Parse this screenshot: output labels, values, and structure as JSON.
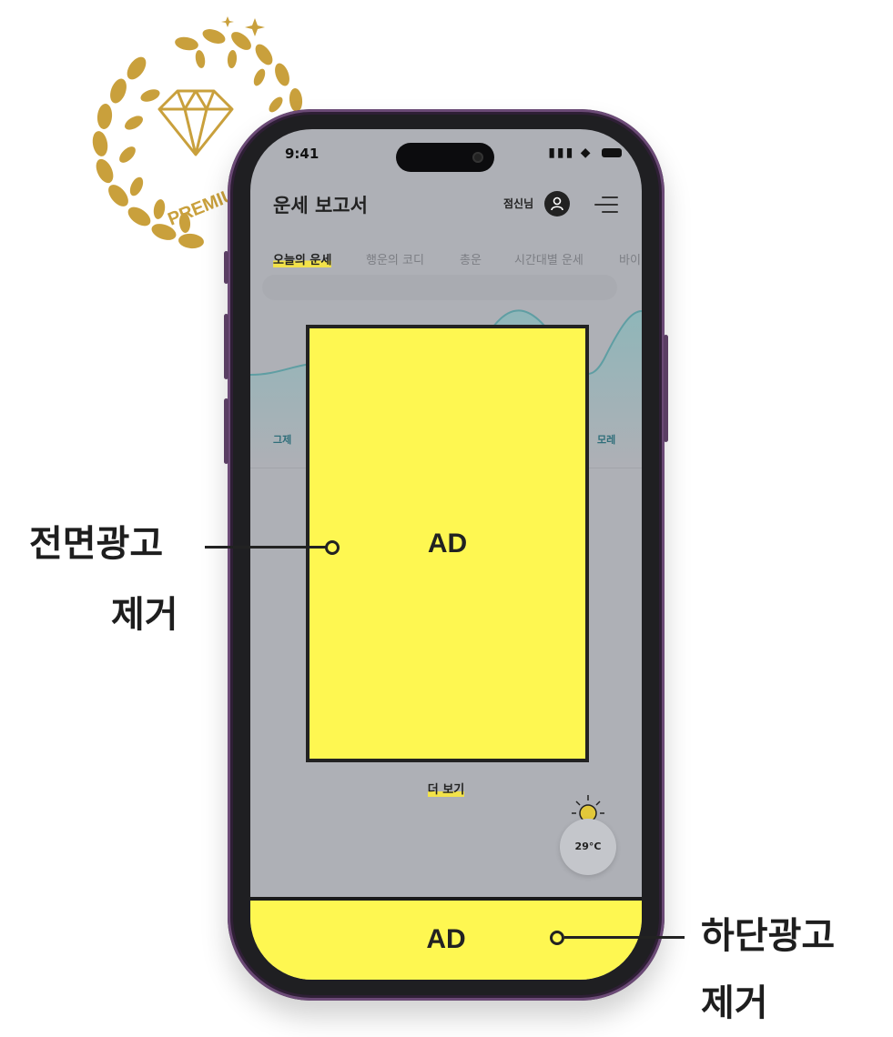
{
  "badge": {
    "text": "PREMIUM",
    "color": "#c9a03c",
    "icon": "diamond-laurel-icon"
  },
  "status_bar": {
    "time": "9:41",
    "icons": "signal-wifi-battery"
  },
  "app": {
    "title": "운세 보고서",
    "user_name": "점신님",
    "avatar_icon": "user-icon",
    "menu_icon": "menu-icon"
  },
  "tabs": [
    {
      "label": "오늘의 운세",
      "active": true
    },
    {
      "label": "행운의 코디",
      "active": false
    },
    {
      "label": "총운",
      "active": false
    },
    {
      "label": "시간대별 운세",
      "active": false
    },
    {
      "label": "바이",
      "active": false
    }
  ],
  "days": {
    "left": "그제",
    "right": "모레"
  },
  "more_button": "더 보기",
  "weather": {
    "temperature": "29°C",
    "icon": "sun-icon"
  },
  "ads": {
    "fullscreen_label": "AD",
    "bottom_label": "AD",
    "color": "#fef751"
  },
  "callouts": {
    "fullscreen": {
      "line1": "전면광고",
      "line2": "제거"
    },
    "bottom": {
      "line1": "하단광고",
      "line2": "제거"
    }
  }
}
